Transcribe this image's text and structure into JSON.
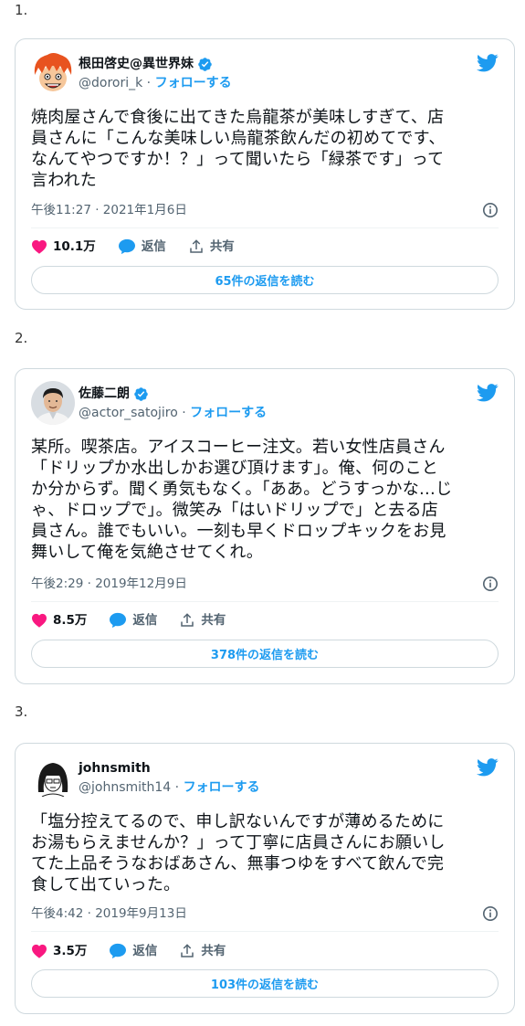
{
  "colors": {
    "accent": "#1d9bf0",
    "like": "#f91880",
    "border": "#cfd9de",
    "muted": "#536471"
  },
  "tweets": [
    {
      "number": "1.",
      "name": "根田啓史@異世界妹",
      "handle": "@dorori_k",
      "follow_label": "フォローする",
      "text": "焼肉屋さんで食後に出てきた烏龍茶が美味しすぎて、店\n員さんに「こんな美味しい烏龍茶飲んだの初めてです、\nなんてやつですか！？」って聞いたら「緑茶です」って\n言われた",
      "timestamp": "午後11:27 · 2021年1月6日",
      "likes": "10.1万",
      "reply_label": "返信",
      "share_label": "共有",
      "replies_button": "65件の返信を読む",
      "avatar_icon": "cartoon-avatar-icon"
    },
    {
      "number": "2.",
      "name": "佐藤二朗",
      "handle": "@actor_satojiro",
      "follow_label": "フォローする",
      "text": "某所。喫茶店。アイスコーヒー注文。若い女性店員さん\n「ドリップか水出しかお選び頂けます」。俺、何のこと\nか分からず。聞く勇気もなく。「ああ。どうすっかな…じ\nゃ、ドロップで」。微笑み「はいドリップで」と去る店\n員さん。誰でもいい。一刻も早くドロップキックをお見\n舞いして俺を気絶させてくれ。",
      "timestamp": "午後2:29 · 2019年12月9日",
      "likes": "8.5万",
      "reply_label": "返信",
      "share_label": "共有",
      "replies_button": "378件の返信を読む",
      "avatar_icon": "photo-avatar-icon"
    },
    {
      "number": "3.",
      "name": "johnsmith",
      "handle": "@johnsmith14",
      "follow_label": "フォローする",
      "text": "「塩分控えてるので、申し訳ないんですが薄めるために\nお湯もらえませんか？」って丁寧に店員さんにお願いし\nてた上品そうなおばあさん、無事つゆをすべて飲んで完\n食して出ていった。",
      "timestamp": "午後4:42 · 2019年9月13日",
      "likes": "3.5万",
      "reply_label": "返信",
      "share_label": "共有",
      "replies_button": "103件の返信を読む",
      "avatar_icon": "sketch-avatar-icon"
    }
  ]
}
